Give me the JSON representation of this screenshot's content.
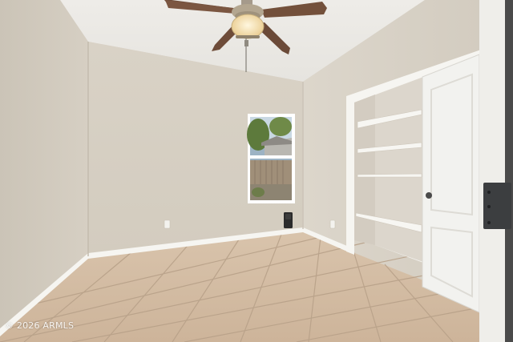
{
  "watermark": "© 2026 ARMLS",
  "palette": {
    "wall": "#d8d1c6",
    "wall_dark": "#c9c1b4",
    "ceiling": "#ecebe7",
    "floor": "#d3bca3",
    "grout": "#b59f86",
    "trim": "#f6f5f1",
    "door": "#f2f2ef",
    "fan_blade": "#6b4a38",
    "window_frame": "#ffffff"
  },
  "icons": {
    "fan": "ceiling-fan-icon",
    "outlet": "power-outlet-icon",
    "speaker": "speaker-icon",
    "hinge": "door-hinge-icon"
  }
}
